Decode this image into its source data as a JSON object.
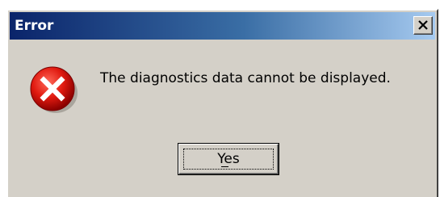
{
  "window": {
    "title": "Error",
    "close_icon": "close-icon"
  },
  "message": {
    "icon": "error-icon",
    "text": "The diagnostics data cannot be displayed."
  },
  "buttons": {
    "yes_label": "Yes"
  },
  "colors": {
    "dialog_face": "#d4d0c8",
    "titlebar_start": "#0a246a",
    "titlebar_end": "#a6caf0",
    "error_red": "#d40000"
  }
}
